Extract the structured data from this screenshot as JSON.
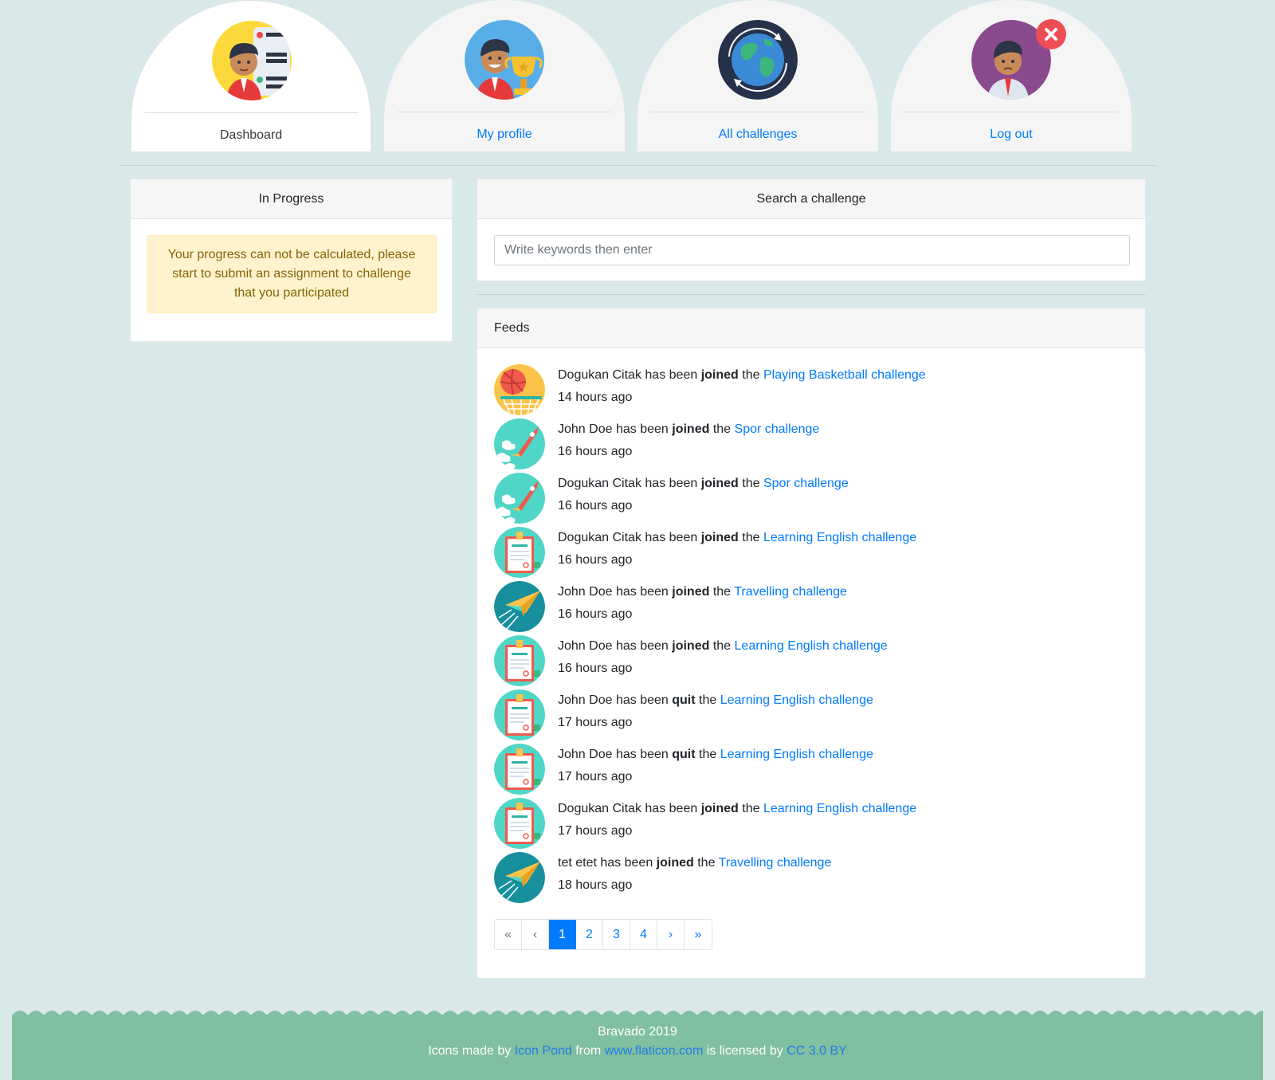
{
  "nav": {
    "tabs": [
      {
        "label": "Dashboard",
        "icon": "dashboard-avatar-icon",
        "active": true
      },
      {
        "label": "My profile",
        "icon": "profile-trophy-avatar-icon",
        "active": false
      },
      {
        "label": "All challenges",
        "icon": "globe-icon",
        "active": false
      },
      {
        "label": "Log out",
        "icon": "logout-avatar-icon",
        "active": false
      }
    ]
  },
  "progress": {
    "header": "In Progress",
    "alert": "Your progress can not be calculated, please start to submit an assignment to challenge that you participated"
  },
  "search": {
    "header": "Search a challenge",
    "placeholder": "Write keywords then enter"
  },
  "feeds": {
    "header": "Feeds",
    "items": [
      {
        "user": "Dogukan Citak",
        "pre": "has been",
        "action": "joined",
        "mid": "the",
        "challenge": "Playing Basketball challenge",
        "time": "14 hours ago",
        "icon": "basketball-icon"
      },
      {
        "user": "John Doe",
        "pre": "has been",
        "action": "joined",
        "mid": "the",
        "challenge": "Spor challenge",
        "time": "16 hours ago",
        "icon": "rocket-icon"
      },
      {
        "user": "Dogukan Citak",
        "pre": "has been",
        "action": "joined",
        "mid": "the",
        "challenge": "Spor challenge",
        "time": "16 hours ago",
        "icon": "rocket-icon"
      },
      {
        "user": "Dogukan Citak",
        "pre": "has been",
        "action": "joined",
        "mid": "the",
        "challenge": "Learning English challenge",
        "time": "16 hours ago",
        "icon": "certificate-icon"
      },
      {
        "user": "John Doe",
        "pre": "has been",
        "action": "joined",
        "mid": "the",
        "challenge": "Travelling challenge",
        "time": "16 hours ago",
        "icon": "paper-plane-icon"
      },
      {
        "user": "John Doe",
        "pre": "has been",
        "action": "joined",
        "mid": "the",
        "challenge": "Learning English challenge",
        "time": "16 hours ago",
        "icon": "certificate-icon"
      },
      {
        "user": "John Doe",
        "pre": "has been",
        "action": "quit",
        "mid": "the",
        "challenge": "Learning English challenge",
        "time": "17 hours ago",
        "icon": "certificate-icon"
      },
      {
        "user": "John Doe",
        "pre": "has been",
        "action": "quit",
        "mid": "the",
        "challenge": "Learning English challenge",
        "time": "17 hours ago",
        "icon": "certificate-icon"
      },
      {
        "user": "Dogukan Citak",
        "pre": "has been",
        "action": "joined",
        "mid": "the",
        "challenge": "Learning English challenge",
        "time": "17 hours ago",
        "icon": "certificate-icon"
      },
      {
        "user": "tet etet",
        "pre": "has been",
        "action": "joined",
        "mid": "the",
        "challenge": "Travelling challenge",
        "time": "18 hours ago",
        "icon": "paper-plane-icon"
      }
    ]
  },
  "pagination": {
    "first": "«",
    "prev": "‹",
    "pages": [
      "1",
      "2",
      "3",
      "4"
    ],
    "current": "1",
    "next": "›",
    "last": "»"
  },
  "footer": {
    "line1": "Bravado 2019",
    "prefix": "Icons made by",
    "author_link": "Icon Pond",
    "from_text": "from",
    "site_link": "www.flaticon.com",
    "licensed_text": "is licensed by",
    "license_link": "CC 3.0 BY"
  },
  "colors": {
    "accent": "#007bff",
    "background": "#d9e9e9",
    "footer": "#80bfa0",
    "alert_bg": "#fff3cd",
    "alert_text": "#856404"
  }
}
